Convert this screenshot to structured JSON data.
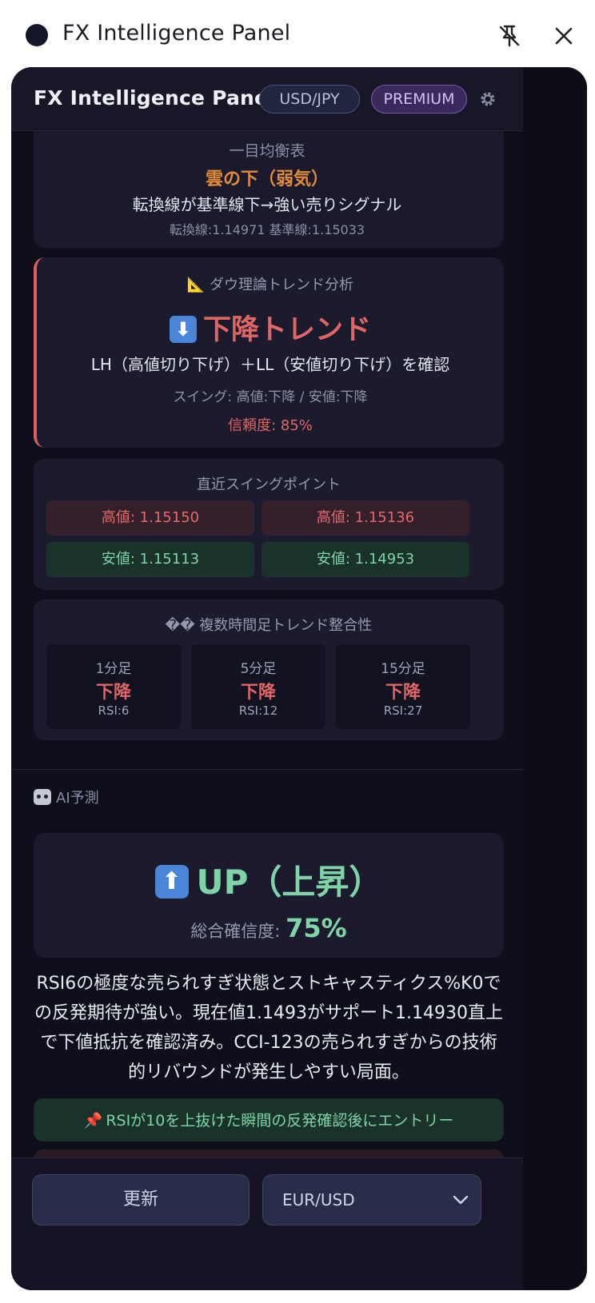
{
  "window": {
    "title": "FX Intelligence Panel"
  },
  "header": {
    "title": "FX Intelligence Panel",
    "pair": "USD/JPY",
    "plan": "PREMIUM"
  },
  "ichimoku": {
    "label": "一目均衡表",
    "status": "雲の下（弱気）",
    "description": "転換線が基準線下→強い売りシグナル",
    "values": "転換線:1.14971 基準線:1.15033"
  },
  "dow": {
    "label": "📐 ダウ理論トレンド分析",
    "trend": "下降トレンド",
    "arrow": "⬇",
    "description": "LH（高値切り下げ）＋LL（安値切り下げ）を確認",
    "swing": "スイング: 高値:下降 / 安値:下降",
    "confidence": "信頼度: 85%"
  },
  "swing_points": {
    "label": "直近スイングポイント",
    "highs": [
      "高値: 1.15150",
      "高値: 1.15136"
    ],
    "lows": [
      "安値: 1.15113",
      "安値: 1.14953"
    ]
  },
  "multi_timeframe": {
    "label": "�� 複数時間足トレンド整合性",
    "frames": [
      {
        "tf": "1分足",
        "dir": "下降",
        "rsi": "RSI:6"
      },
      {
        "tf": "5分足",
        "dir": "下降",
        "rsi": "RSI:12"
      },
      {
        "tf": "15分足",
        "dir": "下降",
        "rsi": "RSI:27"
      }
    ]
  },
  "ai": {
    "section_label": "AI予測",
    "direction": "UP（上昇）",
    "arrow": "⬆",
    "confidence_label": "総合確信度:",
    "confidence_value": "75%",
    "text": "RSI6の極度な売られすぎ状態とストキャスティクス%K0での反発期待が強い。現在値1.1493がサポート1.14930直上で下値抵抗を確認済み。CCI-123の売られすぎからの技術的リバウンドが発生しやすい局面。",
    "entry": "RSIが10を上抜けた瞬間の反発確認後にエントリー"
  },
  "footer": {
    "refresh_label": "更新",
    "selected_pair": "EUR/USD"
  },
  "colors": {
    "bearish": "#e06666",
    "bullish": "#7fd3a6",
    "warning": "#e08a3c",
    "accent": "#4a86d8"
  }
}
